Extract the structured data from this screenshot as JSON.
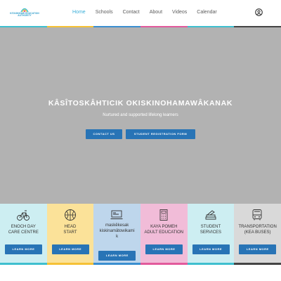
{
  "header": {
    "logo_text": "KITASKINAW EDUCATION AUTHORITY",
    "nav": [
      {
        "label": "Home"
      },
      {
        "label": "Schools"
      },
      {
        "label": "Contact"
      },
      {
        "label": "About"
      },
      {
        "label": "Videos"
      },
      {
        "label": "Calendar"
      }
    ],
    "active_index": 0
  },
  "hero": {
    "title": "KÂSÎTOSKÂHTICIK OKISKINOHAMAWÂKANAK",
    "subtitle": "Nurtured and supported lifelong learners",
    "contact_button": "CONTACT US",
    "registration_button": "STUDENT REGISTRATION FORM"
  },
  "cards": [
    {
      "label_lines": [
        "ENOCH DAY",
        "CARE CENTRE"
      ],
      "button": "LEARN MORE",
      "color": "#cdeef2",
      "bar": "#3fbfcf",
      "icon": "bicycle-icon"
    },
    {
      "label_lines": [
        "HEAD",
        "START"
      ],
      "button": "LEARN MORE",
      "color": "#fbe299",
      "bar": "#f5c136",
      "icon": "basketball-icon"
    },
    {
      "label_lines": [
        "maskêkesak",
        "kiskinamâtowikami",
        "k"
      ],
      "button": "LEARN MORE",
      "color": "#bed6ec",
      "bar": "#3b8fd0",
      "icon": "laptop-icon"
    },
    {
      "label_lines": [
        "KAYA POMEH",
        "ADULT EDUCATION"
      ],
      "button": "LEARN MORE",
      "color": "#f1bcd8",
      "bar": "#e25a9c",
      "icon": "calculator-icon"
    },
    {
      "label_lines": [
        "STUDENT",
        "SERVICES"
      ],
      "button": "LEARN MORE",
      "color": "#cdeef2",
      "bar": "#3fbfcf",
      "icon": "book-stack-icon"
    },
    {
      "label_lines": [
        "TRANSPORTATION",
        "(KEA BUSES)"
      ],
      "button": "LEARN MORE",
      "color": "#d9d9d9",
      "bar": "#444444",
      "icon": "bus-icon"
    }
  ],
  "colors": {
    "accent": "#3aaed8",
    "button": "#2874b6",
    "hero_bg": "#b2b2b2",
    "stripe": [
      "#3fbfcf",
      "#f5c136",
      "#3b8fd0",
      "#e25a9c",
      "#3fbfcf",
      "#444444"
    ]
  }
}
